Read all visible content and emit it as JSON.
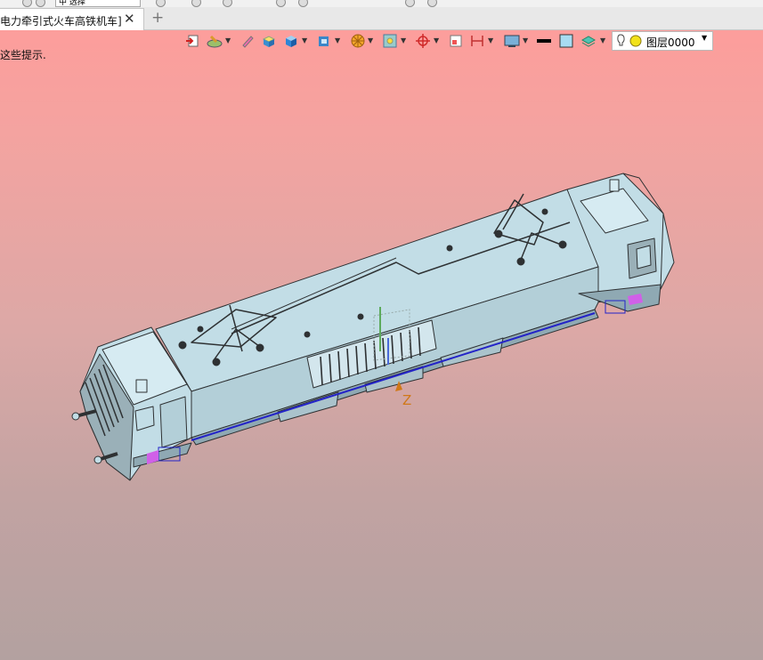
{
  "quick_access": {
    "selector_text": "中 选择"
  },
  "tab": {
    "title": "电力牵引式火车高铁机车]",
    "close_glyph": "✕",
    "add_glyph": "+"
  },
  "hint": "这些提示.",
  "toolbar": {
    "items": [
      "exit-icon",
      "render-style-icon",
      "eraser-icon",
      "shade-icon",
      "solid-box-icon",
      "box-shaded-icon",
      "view-orient-icon",
      "snap-icon",
      "zoom-box-icon",
      "target-icon",
      "frame-icon",
      "measure-icon",
      "display-icon",
      "line-color-icon",
      "fill-color-icon",
      "layer-stack-icon"
    ]
  },
  "layer": {
    "label": "图层0000",
    "dropdown_glyph": "▼"
  },
  "viewport": {
    "axis_label": "Z"
  },
  "colors": {
    "model_fill": "#c2dde6",
    "model_dark": "#2e3133",
    "edge_blue": "#2323c8",
    "accent_magenta": "#d060e8",
    "axis_orange": "#d07818"
  }
}
